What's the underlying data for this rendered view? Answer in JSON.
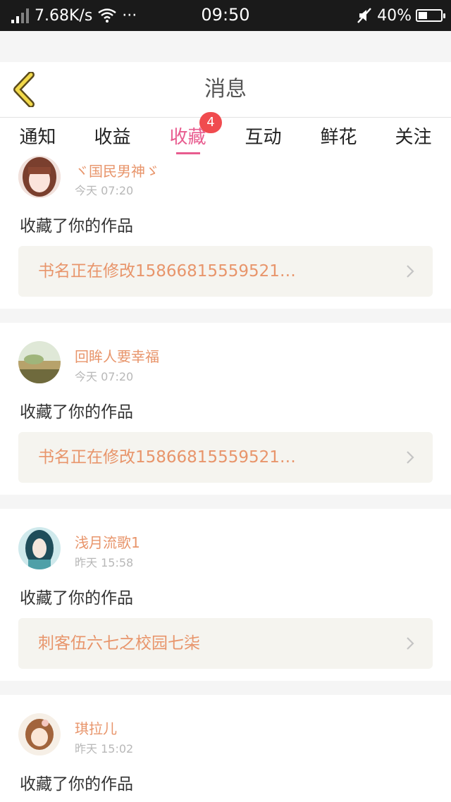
{
  "status_bar": {
    "speed": "7.68K/s",
    "dots": "···",
    "time": "09:50",
    "battery": "40%",
    "battery_level": 0.4
  },
  "header": {
    "title": "消息",
    "back_icon": "chevron-left-icon"
  },
  "tabs": [
    {
      "label": "通知",
      "active": false
    },
    {
      "label": "收益",
      "active": false
    },
    {
      "label": "收藏",
      "active": true,
      "badge": "4"
    },
    {
      "label": "互动",
      "active": false
    },
    {
      "label": "鲜花",
      "active": false
    },
    {
      "label": "关注",
      "active": false
    }
  ],
  "items": [
    {
      "user": "ヾ国民男神ゞ",
      "time": "今天 07:20",
      "action": "收藏了你的作品",
      "work": "书名正在修改15866815559521…"
    },
    {
      "user": "回眸人要幸福",
      "time": "今天 07:20",
      "action": "收藏了你的作品",
      "work": "书名正在修改15866815559521…"
    },
    {
      "user": "浅月流歌1",
      "time": "昨天 15:58",
      "action": "收藏了你的作品",
      "work": "刺客伍六七之校园七柒"
    },
    {
      "user": "琪拉儿",
      "time": "昨天 15:02",
      "action": "收藏了你的作品",
      "work": ""
    }
  ],
  "colors": {
    "accent": "#e85c8f",
    "name": "#e8956b",
    "badge": "#f04b4f"
  }
}
